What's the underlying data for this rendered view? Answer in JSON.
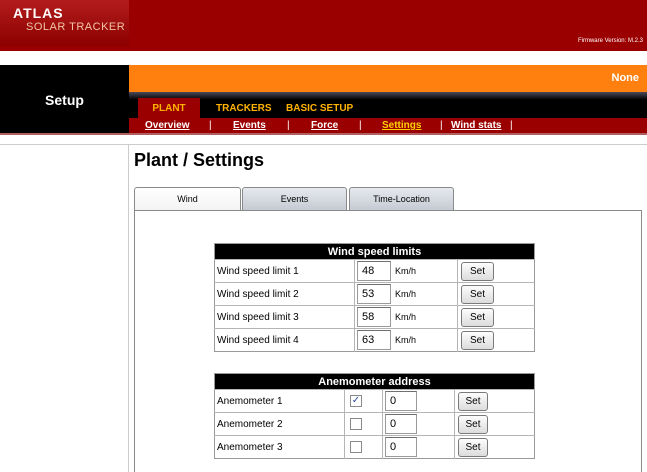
{
  "logo": {
    "title": "ATLAS",
    "subtitle": "SOLAR TRACKER"
  },
  "firmware": "Firmware Version: M.2.3",
  "sidebar": {
    "title": "Setup"
  },
  "status": "None",
  "main_tabs": [
    "PLANT",
    "TRACKERS",
    "BASIC SETUP"
  ],
  "sub_nav": [
    "Overview",
    "Events",
    "Force",
    "Settings",
    "Wind stats"
  ],
  "page_title": "Plant / Settings",
  "panel_tabs": [
    "Wind",
    "Events",
    "Time-Location"
  ],
  "wind_limits": {
    "title": "Wind speed limits",
    "unit": "Km/h",
    "set_label": "Set",
    "rows": [
      {
        "label": "Wind speed limit 1",
        "value": "48"
      },
      {
        "label": "Wind speed limit 2",
        "value": "53"
      },
      {
        "label": "Wind speed limit 3",
        "value": "58"
      },
      {
        "label": "Wind speed limit 4",
        "value": "63"
      }
    ]
  },
  "anemometer": {
    "title": "Anemometer address",
    "set_label": "Set",
    "check_mark": "✓",
    "rows": [
      {
        "label": "Anemometer 1",
        "checked": true,
        "value": "0"
      },
      {
        "label": "Anemometer 2",
        "checked": false,
        "value": "0"
      },
      {
        "label": "Anemometer 3",
        "checked": false,
        "value": "0"
      }
    ]
  }
}
